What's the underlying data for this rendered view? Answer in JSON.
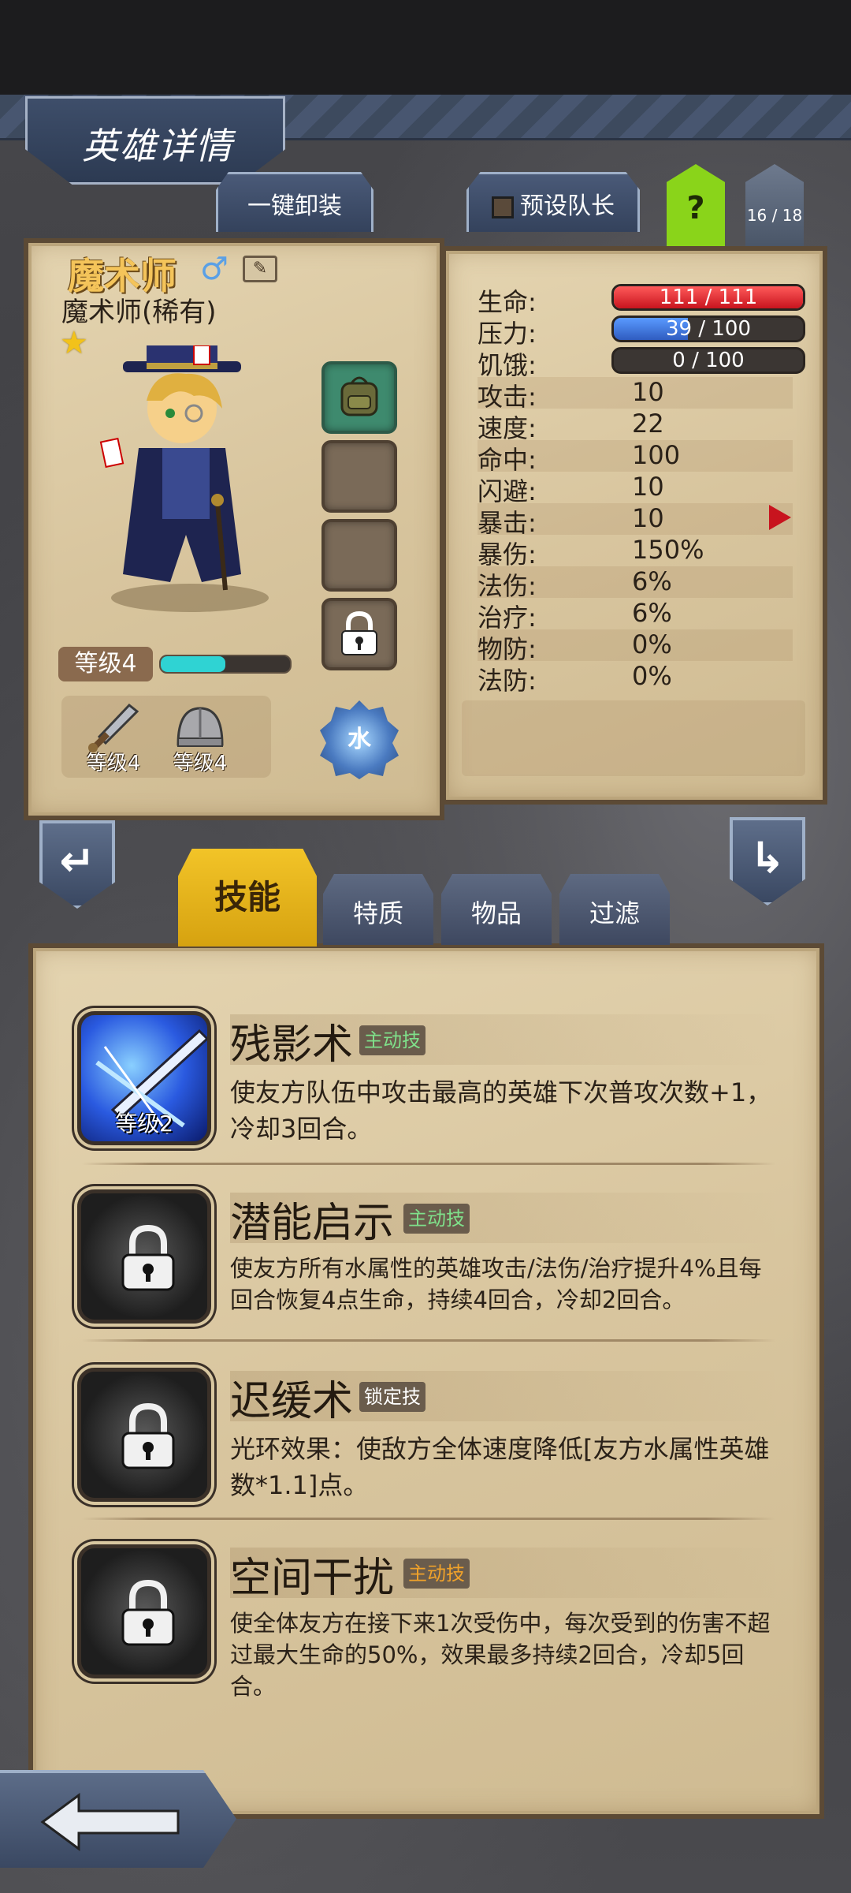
{
  "header": {
    "title": "英雄详情",
    "unequip_all": "一键卸装",
    "preset_leader": "预设队长",
    "help": "?",
    "hero_count": "16 / 18"
  },
  "hero": {
    "name": "魔术师",
    "gender_icon": "male-symbol-icon",
    "subtitle": "魔术师(稀有)",
    "stars": "★",
    "level": "等级4",
    "xp_fraction": 0.5,
    "element": "水",
    "weapon_level": "等级4",
    "armor_level": "等级4"
  },
  "stats": {
    "hp": {
      "label": "生命:",
      "value": "111 / 111",
      "fraction": 1.0,
      "color": "#d8283a"
    },
    "stress": {
      "label": "压力:",
      "value": "39 / 100",
      "fraction": 0.39,
      "color": "#2f6ccf"
    },
    "hunger": {
      "label": "饥饿:",
      "value": "0 / 100",
      "fraction": 0.0,
      "color": "#888888"
    },
    "rows": [
      {
        "label": "攻击:",
        "value": "10"
      },
      {
        "label": "速度:",
        "value": "22"
      },
      {
        "label": "命中:",
        "value": "100"
      },
      {
        "label": "闪避:",
        "value": "10"
      },
      {
        "label": "暴击:",
        "value": "10"
      },
      {
        "label": "暴伤:",
        "value": "150%"
      },
      {
        "label": "法伤:",
        "value": "6%"
      },
      {
        "label": "治疗:",
        "value": "6%"
      },
      {
        "label": "物防:",
        "value": "0%"
      },
      {
        "label": "法防:",
        "value": "0%"
      }
    ]
  },
  "tabs": [
    "技能",
    "特质",
    "物品",
    "过滤"
  ],
  "skills": [
    {
      "name": "残影术",
      "badge": "主动技",
      "badge_color": "#7fe08a",
      "level": "等级2",
      "locked": false,
      "desc": "使友方队伍中攻击最高的英雄下次普攻次数+1，冷却3回合。"
    },
    {
      "name": "潜能启示",
      "badge": "主动技",
      "badge_color": "#7fe08a",
      "level": "",
      "locked": true,
      "desc": "使友方所有水属性的英雄攻击/法伤/治疗提升4%且每回合恢复4点生命，持续4回合，冷却2回合。"
    },
    {
      "name": "迟缓术",
      "badge": "锁定技",
      "badge_color": "#ffffff",
      "level": "",
      "locked": true,
      "desc": "光环效果：使敌方全体速度降低[友方水属性英雄数*1.1]点。"
    },
    {
      "name": "空间干扰",
      "badge": "主动技",
      "badge_color": "#f0a22a",
      "level": "",
      "locked": true,
      "desc": "使全体友方在接下来1次受伤中，每次受到的伤害不超过最大生命的50%，效果最多持续2回合，冷却5回合。"
    }
  ],
  "colors": {
    "accent_gold": "#f2c428",
    "panel_bg": "#d8c59e",
    "xp_cyan": "#2fd3d3",
    "help_green": "#8ad41a"
  }
}
